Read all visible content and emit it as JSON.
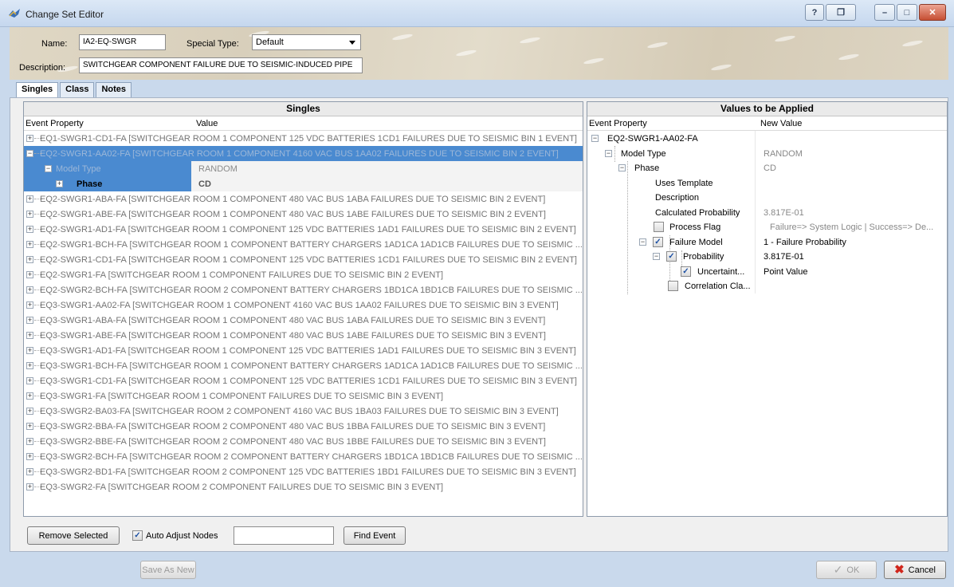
{
  "window": {
    "title": "Change Set Editor",
    "help_glyph": "?",
    "restore_glyph": "❐",
    "minimize_glyph": "–",
    "maximize_glyph": "□",
    "close_glyph": "✕"
  },
  "form": {
    "name_label": "Name:",
    "name_value": "IA2-EQ-SWGR",
    "special_type_label": "Special Type:",
    "special_type_value": "Default",
    "description_label": "Description:",
    "description_value": "SWITCHGEAR COMPONENT FAILURE DUE TO SEISMIC-INDUCED PIPE"
  },
  "tabs": [
    "Singles",
    "Class",
    "Notes"
  ],
  "singles": {
    "title": "Singles",
    "col_property": "Event Property",
    "col_value": "Value",
    "rows": [
      "EQ1-SWGR1-CD1-FA  [SWITCHGEAR ROOM 1 COMPONENT 125 VDC BATTERIES 1CD1 FAILURES DUE TO SEISMIC BIN 1 EVENT]",
      "EQ2-SWGR1-AA02-FA  [SWITCHGEAR ROOM 1 COMPONENT 4160 VAC BUS 1AA02 FAILURES DUE TO SEISMIC BIN 2 EVENT]"
    ],
    "sub_model_type": "Model Type",
    "sub_model_type_value": "RANDOM",
    "sub_phase": "Phase",
    "sub_phase_value": "CD",
    "rows_after": [
      "EQ2-SWGR1-ABA-FA  [SWITCHGEAR ROOM 1 COMPONENT 480 VAC BUS 1ABA FAILURES DUE TO SEISMIC BIN 2 EVENT]",
      "EQ2-SWGR1-ABE-FA  [SWITCHGEAR ROOM 1 COMPONENT 480 VAC BUS 1ABE FAILURES DUE TO SEISMIC BIN 2 EVENT]",
      "EQ2-SWGR1-AD1-FA  [SWITCHGEAR ROOM 1 COMPONENT 125 VDC BATTERIES 1AD1 FAILURES DUE TO SEISMIC BIN 2 EVENT]",
      "EQ2-SWGR1-BCH-FA  [SWITCHGEAR ROOM 1 COMPONENT BATTERY CHARGERS 1AD1CA 1AD1CB FAILURES DUE TO SEISMIC ...",
      "EQ2-SWGR1-CD1-FA  [SWITCHGEAR ROOM 1 COMPONENT 125 VDC BATTERIES 1CD1 FAILURES DUE TO SEISMIC BIN 2 EVENT]",
      "EQ2-SWGR1-FA  [SWITCHGEAR ROOM 1 COMPONENT FAILURES DUE TO SEISMIC BIN 2 EVENT]",
      "EQ2-SWGR2-BCH-FA  [SWITCHGEAR ROOM 2 COMPONENT BATTERY CHARGERS 1BD1CA 1BD1CB FAILURES DUE TO SEISMIC ...",
      "EQ3-SWGR1-AA02-FA  [SWITCHGEAR ROOM 1 COMPONENT 4160 VAC BUS 1AA02 FAILURES DUE TO SEISMIC BIN 3 EVENT]",
      "EQ3-SWGR1-ABA-FA  [SWITCHGEAR ROOM 1 COMPONENT 480 VAC BUS 1ABA FAILURES DUE TO SEISMIC BIN 3 EVENT]",
      "EQ3-SWGR1-ABE-FA  [SWITCHGEAR ROOM 1 COMPONENT 480 VAC BUS 1ABE FAILURES DUE TO SEISMIC BIN 3 EVENT]",
      "EQ3-SWGR1-AD1-FA  [SWITCHGEAR ROOM 1 COMPONENT 125 VDC BATTERIES 1AD1 FAILURES DUE TO SEISMIC BIN 3 EVENT]",
      "EQ3-SWGR1-BCH-FA  [SWITCHGEAR ROOM 1 COMPONENT BATTERY CHARGERS 1AD1CA 1AD1CB FAILURES DUE TO SEISMIC ...",
      "EQ3-SWGR1-CD1-FA  [SWITCHGEAR ROOM 1 COMPONENT 125 VDC BATTERIES 1CD1 FAILURES DUE TO SEISMIC BIN 3 EVENT]",
      "EQ3-SWGR1-FA  [SWITCHGEAR ROOM 1 COMPONENT FAILURES DUE TO SEISMIC BIN 3 EVENT]",
      "EQ3-SWGR2-BA03-FA  [SWITCHGEAR ROOM 2 COMPONENT 4160 VAC BUS 1BA03 FAILURES DUE TO SEISMIC BIN 3 EVENT]",
      "EQ3-SWGR2-BBA-FA  [SWITCHGEAR ROOM 2 COMPONENT 480 VAC BUS 1BBA FAILURES DUE TO SEISMIC BIN 3 EVENT]",
      "EQ3-SWGR2-BBE-FA  [SWITCHGEAR ROOM 2 COMPONENT 480 VAC BUS 1BBE FAILURES DUE TO SEISMIC BIN 3 EVENT]",
      "EQ3-SWGR2-BCH-FA  [SWITCHGEAR ROOM 2 COMPONENT BATTERY CHARGERS 1BD1CA 1BD1CB FAILURES DUE TO SEISMIC ...",
      "EQ3-SWGR2-BD1-FA  [SWITCHGEAR ROOM 2 COMPONENT 125 VDC BATTERIES 1BD1 FAILURES DUE TO SEISMIC BIN 3 EVENT]",
      "EQ3-SWGR2-FA  [SWITCHGEAR ROOM 2 COMPONENT FAILURES DUE TO SEISMIC BIN 3 EVENT]"
    ]
  },
  "values": {
    "title": "Values to be Applied",
    "col_property": "Event Property",
    "col_value": "New Value",
    "root": "EQ2-SWGR1-AA02-FA",
    "model_type": "Model Type",
    "model_type_value": "RANDOM",
    "phase": "Phase",
    "phase_value": "CD",
    "uses_template": "Uses Template",
    "description": "Description",
    "calculated_probability": "Calculated Probability",
    "calculated_probability_value": "3.817E-01",
    "process_flag": "Process Flag",
    "process_flag_value": "Failure=> System Logic   | Success=> De...",
    "failure_model": "Failure Model",
    "failure_model_value": "1 - Failure Probability",
    "probability": "Probability",
    "probability_value": "3.817E-01",
    "uncertainty": "Uncertaint...",
    "uncertainty_value": "Point Value",
    "correlation_class": "Correlation Cla..."
  },
  "controls": {
    "remove_selected": "Remove Selected",
    "auto_adjust": "Auto Adjust Nodes",
    "find_event": "Find Event",
    "search_value": "",
    "save_as_new": "Save As New",
    "ok": "OK",
    "cancel": "Cancel",
    "check_glyph": "✓",
    "ok_glyph": "✓",
    "cancel_glyph": "✖"
  },
  "colors": {
    "selection": "#4a8ad0",
    "cancel_icon": "#d0261c"
  }
}
